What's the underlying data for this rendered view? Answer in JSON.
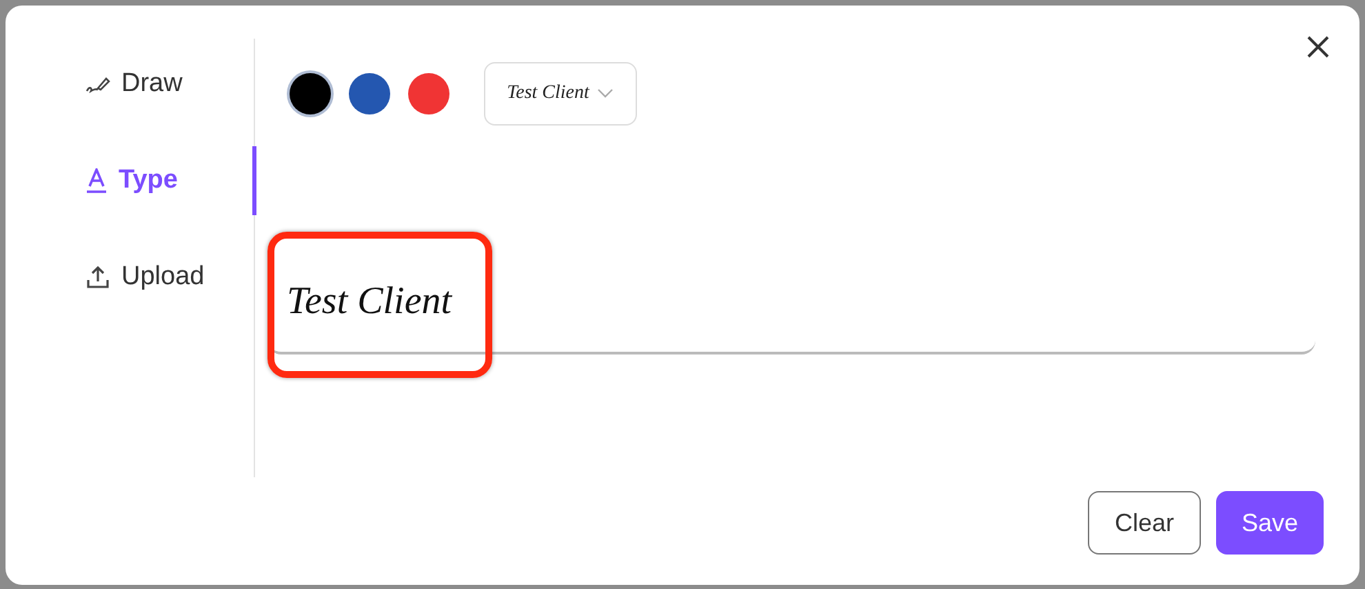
{
  "tabs": [
    {
      "label": "Draw",
      "kind": "draw",
      "selected": false
    },
    {
      "label": "Type",
      "kind": "type",
      "selected": true
    },
    {
      "label": "Upload",
      "kind": "upload",
      "selected": false
    }
  ],
  "colors": [
    {
      "color": "#000000",
      "selected": true
    },
    {
      "color": "#2457b0",
      "selected": false
    },
    {
      "color": "#f03434",
      "selected": false
    }
  ],
  "font_select": {
    "value": "Test Client"
  },
  "signature": {
    "value": "Test Client",
    "highlighted": true
  },
  "buttons": [
    {
      "label": "Clear",
      "kind": "secondary"
    },
    {
      "label": "Save",
      "kind": "primary"
    }
  ]
}
